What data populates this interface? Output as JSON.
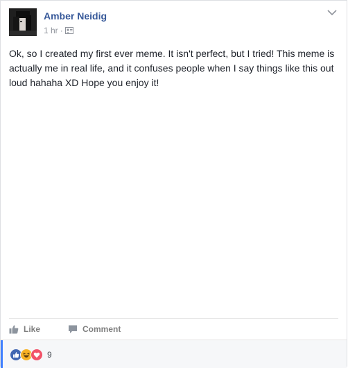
{
  "post": {
    "author": "Amber Neidig",
    "time": "1 hr",
    "separator": "·",
    "text": "Ok, so I created my first ever meme. It isn't perfect, but I tried! This meme is actually me in real life, and it confuses people when I say things like this out loud hahaha XD Hope you enjoy it!"
  },
  "actions": {
    "like_label": "Like",
    "comment_label": "Comment"
  },
  "reactions": {
    "icons": [
      "like-icon",
      "haha-icon",
      "love-icon"
    ],
    "count": "9"
  },
  "colors": {
    "author": "#365899",
    "accent": "#4080ff",
    "like_blue": "#4267b2",
    "love_red": "#f25268",
    "haha_yellow": "#f7b125"
  }
}
